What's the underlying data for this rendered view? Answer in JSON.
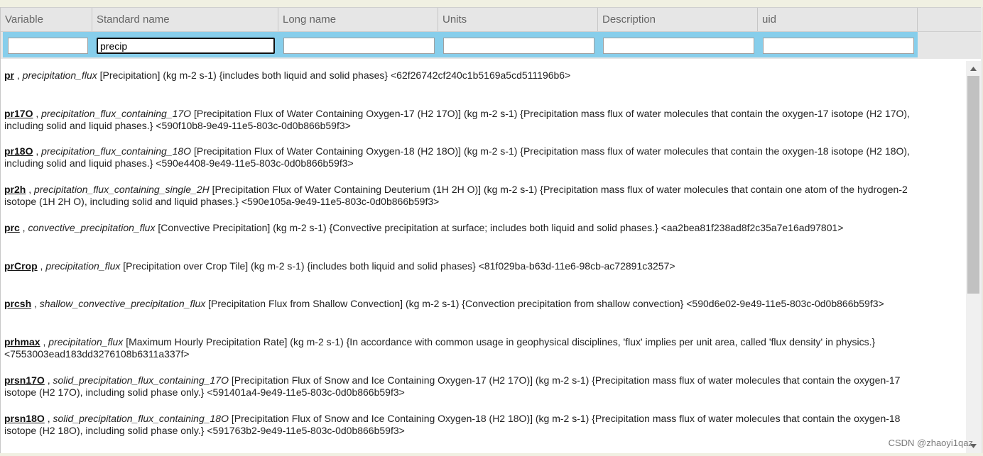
{
  "columns": [
    {
      "label": "Variable"
    },
    {
      "label": "Standard name"
    },
    {
      "label": "Long name"
    },
    {
      "label": "Units"
    },
    {
      "label": "Description"
    },
    {
      "label": "uid"
    }
  ],
  "filters": {
    "variable": "",
    "standard_name": "precip",
    "long_name": "",
    "units": "",
    "description": "",
    "uid": ""
  },
  "results": [
    {
      "var": "pr",
      "std": "precipitation_flux",
      "long": "[Precipitation]",
      "units": "(kg m-2 s-1)",
      "desc": "{includes both liquid and solid phases}",
      "uid": "<62f26742cf240c1b5169a5cd511196b6>"
    },
    {
      "var": "pr17O",
      "std": "precipitation_flux_containing_17O",
      "long": "[Precipitation Flux of Water Containing Oxygen-17 (H2 17O)]",
      "units": "(kg m-2 s-1)",
      "desc": "{Precipitation mass flux of water molecules that contain the oxygen-17 isotope (H2 17O), including solid and liquid phases.}",
      "uid": "<590f10b8-9e49-11e5-803c-0d0b866b59f3>"
    },
    {
      "var": "pr18O",
      "std": "precipitation_flux_containing_18O",
      "long": "[Precipitation Flux of Water Containing Oxygen-18 (H2 18O)]",
      "units": "(kg m-2 s-1)",
      "desc": "{Precipitation mass flux of water molecules that contain the oxygen-18 isotope (H2 18O), including solid and liquid phases.}",
      "uid": "<590e4408-9e49-11e5-803c-0d0b866b59f3>"
    },
    {
      "var": "pr2h",
      "std": "precipitation_flux_containing_single_2H",
      "long": "[Precipitation Flux of Water Containing Deuterium (1H 2H O)]",
      "units": "(kg m-2 s-1)",
      "desc": "{Precipitation mass flux of water molecules that contain one atom of the hydrogen-2 isotope (1H 2H O), including solid and liquid phases.}",
      "uid": "<590e105a-9e49-11e5-803c-0d0b866b59f3>"
    },
    {
      "var": "prc",
      "std": "convective_precipitation_flux",
      "long": "[Convective Precipitation]",
      "units": "(kg m-2 s-1)",
      "desc": "{Convective precipitation at surface; includes both liquid and solid phases.}",
      "uid": "<aa2bea81f238ad8f2c35a7e16ad97801>"
    },
    {
      "var": "prCrop",
      "std": "precipitation_flux",
      "long": "[Precipitation over Crop Tile]",
      "units": "(kg m-2 s-1)",
      "desc": "{includes both liquid and solid phases}",
      "uid": "<81f029ba-b63d-11e6-98cb-ac72891c3257>"
    },
    {
      "var": "prcsh",
      "std": "shallow_convective_precipitation_flux",
      "long": "[Precipitation Flux from Shallow Convection]",
      "units": "(kg m-2 s-1)",
      "desc": "{Convection precipitation from shallow convection}",
      "uid": "<590d6e02-9e49-11e5-803c-0d0b866b59f3>"
    },
    {
      "var": "prhmax",
      "std": "precipitation_flux",
      "long": "[Maximum Hourly Precipitation Rate]",
      "units": "(kg m-2 s-1)",
      "desc": "{In accordance with common usage in geophysical disciplines, 'flux' implies per unit area, called 'flux density' in physics.}",
      "uid": "<7553003ead183dd3276108b6311a337f>"
    },
    {
      "var": "prsn17O",
      "std": "solid_precipitation_flux_containing_17O",
      "long": "[Precipitation Flux of Snow and Ice Containing Oxygen-17 (H2 17O)]",
      "units": "(kg m-2 s-1)",
      "desc": "{Precipitation mass flux of water molecules that contain the oxygen-17 isotope (H2 17O), including solid phase only.}",
      "uid": "<591401a4-9e49-11e5-803c-0d0b866b59f3>"
    },
    {
      "var": "prsn18O",
      "std": "solid_precipitation_flux_containing_18O",
      "long": "[Precipitation Flux of Snow and Ice Containing Oxygen-18 (H2 18O)]",
      "units": "(kg m-2 s-1)",
      "desc": "{Precipitation mass flux of water molecules that contain the oxygen-18 isotope (H2 18O), including solid phase only.}",
      "uid": "<591763b2-9e49-11e5-803c-0d0b866b59f3>"
    }
  ],
  "watermark": "CSDN @zhaoyi1qaz",
  "colors": {
    "filter_band": "#87ceeb",
    "header_bg": "#e6e6e6",
    "scroll_thumb": "#c1c1c1"
  },
  "icons": {
    "scroll_up": "triangle-up-icon",
    "scroll_down": "triangle-down-icon"
  }
}
